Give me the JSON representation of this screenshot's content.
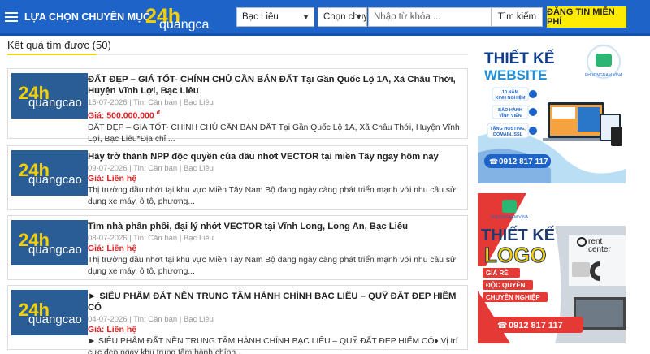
{
  "header": {
    "category_label": "LỰA CHỌN CHUYÊN MỤC",
    "logo_number": "24h",
    "logo_text": "quangcao",
    "location_select": "Bạc Liêu",
    "type_select": "Chọn chuyê",
    "search_placeholder": "Nhập từ khóa ...",
    "search_button": "Tìm kiếm",
    "post_button": "ĐĂNG TIN MIỄN PHÍ"
  },
  "results": {
    "title": "Kết quả tìm được (50)"
  },
  "listings": [
    {
      "title": "ĐẤT ĐẸP – GIÁ TỐT- CHÍNH CHỦ CẦN BÁN ĐẤT Tại Gần Quốc Lộ 1A, Xã Châu Thới, Huyện Vĩnh Lợi, Bạc Liêu",
      "meta": "15-07-2026 | Tin: Căn bán | Bạc Liêu",
      "price": "Giá: 500.000.000",
      "currency": "đ",
      "desc": "ĐẤT ĐẸP – GIÁ TỐT- CHÍNH CHỦ CẦN BÁN ĐẤT Tại Gần Quốc Lộ 1A, Xã Châu Thới, Huyện Vĩnh Lợi, Bạc Liêu*Địa chỉ:..."
    },
    {
      "title": "Hãy trở thành NPP độc quyền của dầu nhớt VECTOR tại miền Tây ngay hôm nay",
      "meta": "09-07-2026 | Tin: Căn bán | Bạc Liêu",
      "price": "Giá: Liên hệ",
      "currency": "",
      "desc": "Thị trường dầu nhớt tại khu vực Miền Tây Nam Bộ đang ngày càng phát triển mạnh với nhu cầu sử dụng xe máy, ô tô, phương..."
    },
    {
      "title": "Tìm nhà phân phối, đại lý nhớt VECTOR tại Vĩnh Long, Long An, Bạc Liêu",
      "meta": "08-07-2026 | Tin: Căn bán | Bạc Liêu",
      "price": "Giá: Liên hệ",
      "currency": "",
      "desc": "Thị trường dầu nhớt tại khu vực Miền Tây Nam Bộ đang ngày càng phát triển mạnh với nhu cầu sử dụng xe máy, ô tô, phương..."
    },
    {
      "title": "► SIÊU PHẨM ĐẤT NỀN TRUNG TÂM HÀNH CHÍNH BẠC LIÊU – QUỸ ĐẤT ĐẸP HIẾM CÓ",
      "meta": "04-07-2026 | Tin: Căn bán | Bạc Liêu",
      "price": "Giá: Liên hệ",
      "currency": "",
      "desc": "► SIÊU PHẨM ĐẤT NỀN TRUNG TÂM HÀNH CHÍNH BẠC LIÊU – QUỸ ĐẤT ĐẸP HIẾM CÓ♦ Vị trí cực đẹp ngay khu trung tâm hành chính..."
    }
  ],
  "ad_website": {
    "title1": "THIẾT KẾ",
    "title2": "WEBSITE",
    "brand": "PHUONGNAM VINA",
    "f1a": "10 NĂM",
    "f1b": "KINH NGHIỆM",
    "f2a": "BẢO HÀNH",
    "f2b": "VĨNH VIỄN",
    "f3a": "TẶNG HOSTING,",
    "f3b": "DOMAIN, SSL",
    "phone": "0912 817 117"
  },
  "ad_logo": {
    "brand": "PHUONGNAM VINA",
    "title1": "THIẾT KẾ",
    "title2": "LOGO",
    "rent1": "rent",
    "rent2": "center",
    "t1": "GIÁ RẺ",
    "t2": "ĐỘC QUYỀN",
    "t3": "CHUYÊN NGHIỆP",
    "phone": "0912 817 117"
  },
  "colors": {
    "header_bg": "#1e64c8",
    "post_button": "#ffeb00",
    "price": "#e02020",
    "thumb_bg": "#2a5d96",
    "logo_yellow": "#f5d000"
  }
}
